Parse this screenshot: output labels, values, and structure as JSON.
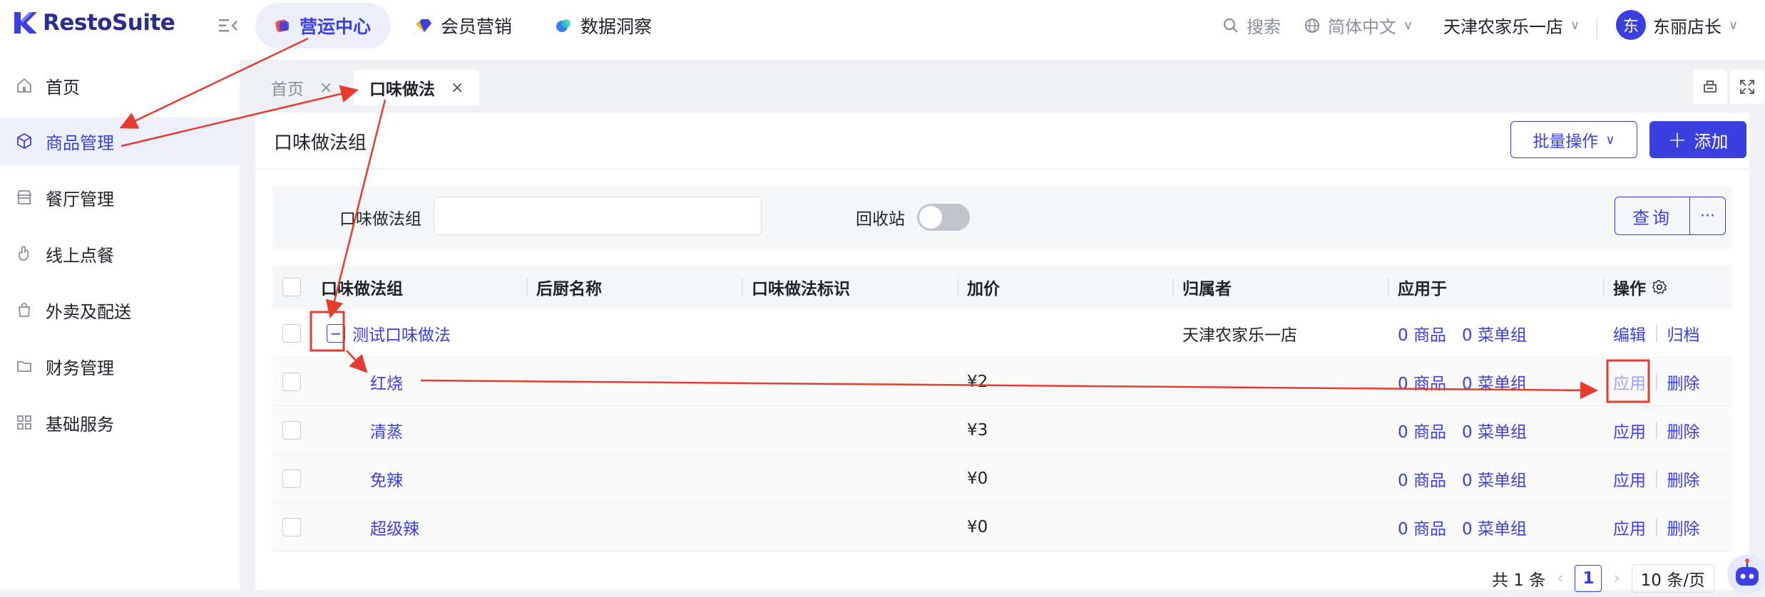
{
  "brand": {
    "name": "RestoSuite"
  },
  "topnav": {
    "tabs": [
      {
        "label": "营运中心",
        "color": "#e9524a"
      },
      {
        "label": "会员营销",
        "color": "#3b3fe0"
      },
      {
        "label": "数据洞察",
        "color": "#3b7cf0"
      }
    ],
    "search_label": "搜索",
    "language": "简体中文",
    "store": "天津农家乐一店",
    "user_initial": "东",
    "user_name": "东丽店长"
  },
  "sidebar": {
    "items": [
      {
        "label": "首页",
        "icon": "home-icon"
      },
      {
        "label": "商品管理",
        "icon": "cube-icon"
      },
      {
        "label": "餐厅管理",
        "icon": "store-icon"
      },
      {
        "label": "线上点餐",
        "icon": "hand-tap-icon"
      },
      {
        "label": "外卖及配送",
        "icon": "bag-icon"
      },
      {
        "label": "财务管理",
        "icon": "folder-icon"
      },
      {
        "label": "基础服务",
        "icon": "grid-icon"
      }
    ]
  },
  "page_tabs": [
    {
      "label": "首页",
      "close": "×"
    },
    {
      "label": "口味做法",
      "close": "×"
    }
  ],
  "panel": {
    "title": "口味做法组",
    "batch_label": "批量操作",
    "add_label": "添加"
  },
  "filters": {
    "group_label": "口味做法组",
    "group_value": "",
    "recycle_label": "回收站",
    "query_label": "查询",
    "more_label": "···"
  },
  "table": {
    "headers": [
      "口味做法组",
      "后厨名称",
      "口味做法标识",
      "加价",
      "归属者",
      "应用于",
      "操作"
    ],
    "group_row": {
      "name": "测试口味做法",
      "owner": "天津农家乐一店",
      "goods": "0 商品",
      "menus": "0 菜单组",
      "op1": "编辑",
      "op2": "归档"
    },
    "children": [
      {
        "name": "红烧",
        "price": "¥2",
        "goods": "0 商品",
        "menus": "0 菜单组",
        "op1": "应用",
        "op2": "删除"
      },
      {
        "name": "清蒸",
        "price": "¥3",
        "goods": "0 商品",
        "menus": "0 菜单组",
        "op1": "应用",
        "op2": "删除"
      },
      {
        "name": "免辣",
        "price": "¥0",
        "goods": "0 商品",
        "menus": "0 菜单组",
        "op1": "应用",
        "op2": "删除"
      },
      {
        "name": "超级辣",
        "price": "¥0",
        "goods": "0 商品",
        "menus": "0 菜单组",
        "op1": "应用",
        "op2": "删除"
      }
    ]
  },
  "pagination": {
    "total": "共 1 条",
    "current": "1",
    "page_size": "10 条/页"
  },
  "colors": {
    "accent": "#3b3fe0",
    "annotation": "#e63b2e"
  }
}
